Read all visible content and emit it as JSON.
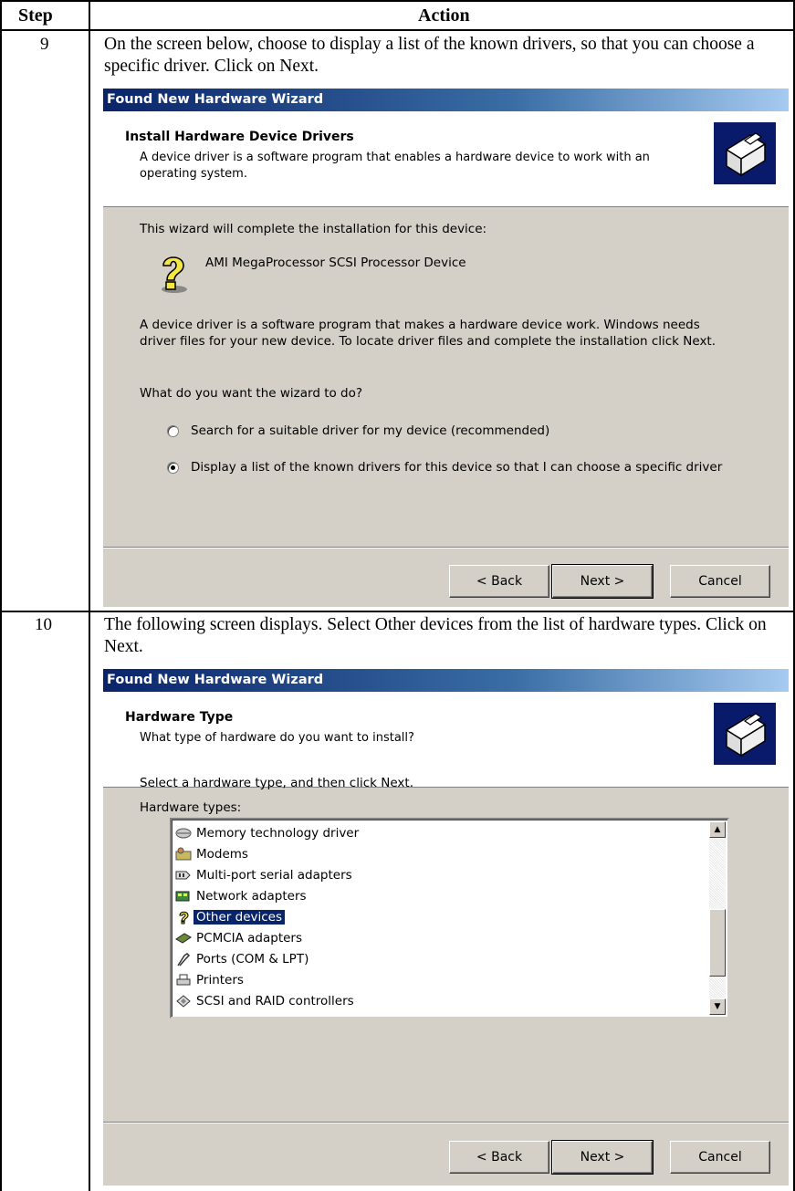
{
  "table": {
    "header_step": "Step",
    "header_action": "Action"
  },
  "rows": [
    {
      "step": "9",
      "instruction": "On the screen below, choose to display a list of the known drivers, so that you can choose a specific driver. Click on Next.",
      "wizard": {
        "title": "Found New Hardware Wizard",
        "heading": "Install Hardware Device Drivers",
        "subheading": "A device driver is a software program that enables a hardware device to work with an operating system.",
        "intro": "This wizard will complete the installation for this device:",
        "device_name": "AMI MegaProcessor SCSI Processor Device",
        "paragraph": "A device driver is a software program that makes a hardware device work. Windows needs driver files for your new device. To locate driver files and complete the installation click Next.",
        "question": "What do you want the wizard to do?",
        "option_search": "Search for a suitable driver for my device (recommended)",
        "option_display": "Display a list of the known drivers for this device so that I can choose a specific driver",
        "selected_option": "option_display",
        "back": "< Back",
        "next": "Next >",
        "cancel": "Cancel"
      }
    },
    {
      "step": "10",
      "instruction": "The following screen displays. Select Other devices from the list of hardware types. Click on Next.",
      "wizard": {
        "title": "Found New Hardware Wizard",
        "heading": "Hardware Type",
        "subheading": "What type of hardware do you want to install?",
        "intro": "Select a hardware type, and then click Next.",
        "list_label": "Hardware types:",
        "list_items": [
          {
            "label": "Memory technology driver",
            "icon": "memory-driver-icon"
          },
          {
            "label": "Modems",
            "icon": "modem-icon"
          },
          {
            "label": "Multi-port serial adapters",
            "icon": "serial-adapter-icon"
          },
          {
            "label": "Network adapters",
            "icon": "network-adapter-icon"
          },
          {
            "label": "Other devices",
            "icon": "question-mark-icon"
          },
          {
            "label": "PCMCIA adapters",
            "icon": "pcmcia-icon"
          },
          {
            "label": "Ports (COM & LPT)",
            "icon": "port-connector-icon"
          },
          {
            "label": "Printers",
            "icon": "printer-icon"
          },
          {
            "label": "SCSI and RAID controllers",
            "icon": "scsi-controller-icon"
          }
        ],
        "selected_item": "Other devices",
        "back": "< Back",
        "next": "Next >",
        "cancel": "Cancel"
      }
    }
  ]
}
